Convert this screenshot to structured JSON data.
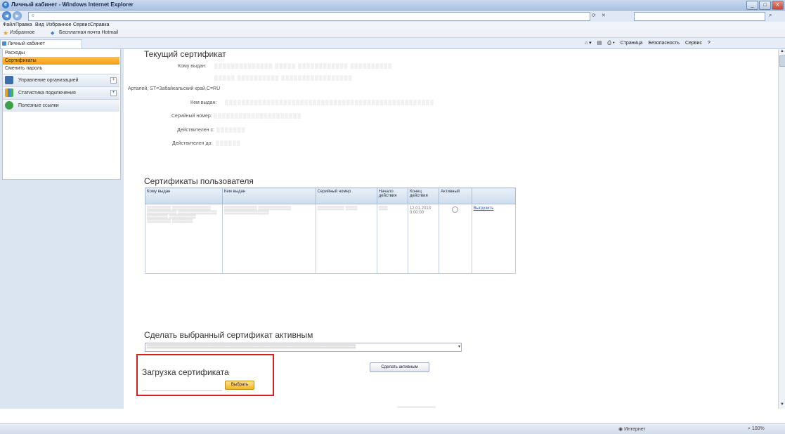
{
  "window": {
    "title": "Личный кабинет - Windows Internet Explorer",
    "controls": [
      "_",
      "□",
      "X"
    ]
  },
  "menu": [
    "Файл",
    "Правка",
    "Вид",
    "Избранное",
    "Сервис",
    "Справка"
  ],
  "favorites": {
    "label": "Избранное",
    "item": "Бесплатная почта Hotmail"
  },
  "tab": {
    "label": "Личный кабинет"
  },
  "commandbar": [
    "Страница",
    "Безопасность",
    "Сервис"
  ],
  "sidebar": {
    "items": [
      {
        "label": "Расходы"
      },
      {
        "label": "Сертификаты",
        "active": true
      },
      {
        "label": "Сменить пароль"
      }
    ],
    "sections": [
      {
        "label": "Управление организацией"
      },
      {
        "label": "Статистика подключения"
      },
      {
        "label": "Полезные ссылки"
      }
    ]
  },
  "current_cert": {
    "heading": "Текущий сертификат",
    "issued_to_label": "Кому выдан:",
    "issued_to_suffix": "Арталей, ST=Забайкальский край,C=RU",
    "issued_by_label": "Кем выдан:",
    "serial_label": "Серийный номер:",
    "valid_from_label": "Действителен с:",
    "valid_to_label": "Действителен до:"
  },
  "user_certs": {
    "heading": "Сертификаты пользователя",
    "columns": [
      "Кому выдан",
      "Кем выдан",
      "Серийный номер",
      "Начало действия",
      "Конец действия",
      "Активный"
    ],
    "row": {
      "end_date": "12.01.2013 0:00:00",
      "action": "Выгрузить"
    }
  },
  "make_active": {
    "heading": "Сделать выбранный сертификат активным",
    "button": "Сделать активным"
  },
  "upload": {
    "heading": "Загрузка сертификата",
    "button": "Выбрать"
  },
  "statusbar": {
    "zone": "Интернет",
    "zoom": "100%"
  }
}
